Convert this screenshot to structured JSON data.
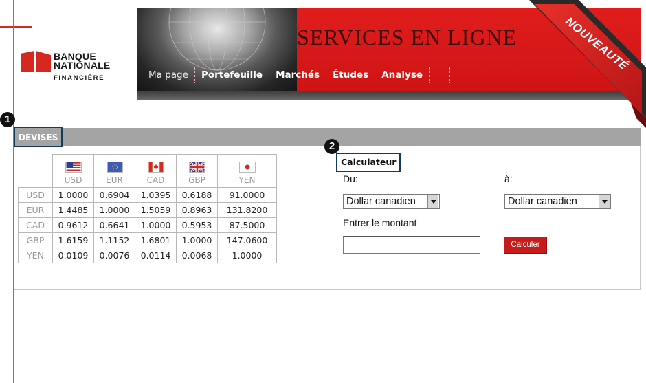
{
  "header": {
    "bank_name_line1": "BANQUE",
    "bank_name_line2": "NATIONALE",
    "bank_name_line3": "FINANCIÈRE",
    "title": "SERVICES EN LIGNE",
    "ribbon": "NOUVEAUTÉ",
    "nav": [
      "Ma page",
      "Portefeuille",
      "Marchés",
      "Études",
      "Analyse"
    ],
    "active_nav": "Ma page",
    "brand_red": "#d5281f"
  },
  "markers": [
    "1",
    "2"
  ],
  "devises": {
    "label": "DEVISES",
    "currencies": [
      "USD",
      "EUR",
      "CAD",
      "GBP",
      "YEN"
    ],
    "flag_icons": [
      "us-flag-icon",
      "eu-flag-icon",
      "canada-flag-icon",
      "uk-flag-icon",
      "japan-flag-icon"
    ],
    "rows": [
      {
        "code": "USD",
        "values": [
          "1.0000",
          "0.6904",
          "1.0395",
          "0.6188",
          "91.0000"
        ]
      },
      {
        "code": "EUR",
        "values": [
          "1.4485",
          "1.0000",
          "1.5059",
          "0.8963",
          "131.8200"
        ]
      },
      {
        "code": "CAD",
        "values": [
          "0.9612",
          "0.6641",
          "1.0000",
          "0.5953",
          "87.5000"
        ]
      },
      {
        "code": "GBP",
        "values": [
          "1.6159",
          "1.1152",
          "1.6801",
          "1.0000",
          "147.0600"
        ]
      },
      {
        "code": "YEN",
        "values": [
          "0.0109",
          "0.0076",
          "0.0114",
          "0.0068",
          "1.0000"
        ]
      }
    ]
  },
  "calculator": {
    "title": "Calculateur",
    "from_label": "Du:",
    "to_label": "à:",
    "from_value": "Dollar canadien",
    "to_value": "Dollar canadien",
    "amount_label": "Entrer le montant",
    "amount_value": "",
    "button_label": "Calculer"
  }
}
